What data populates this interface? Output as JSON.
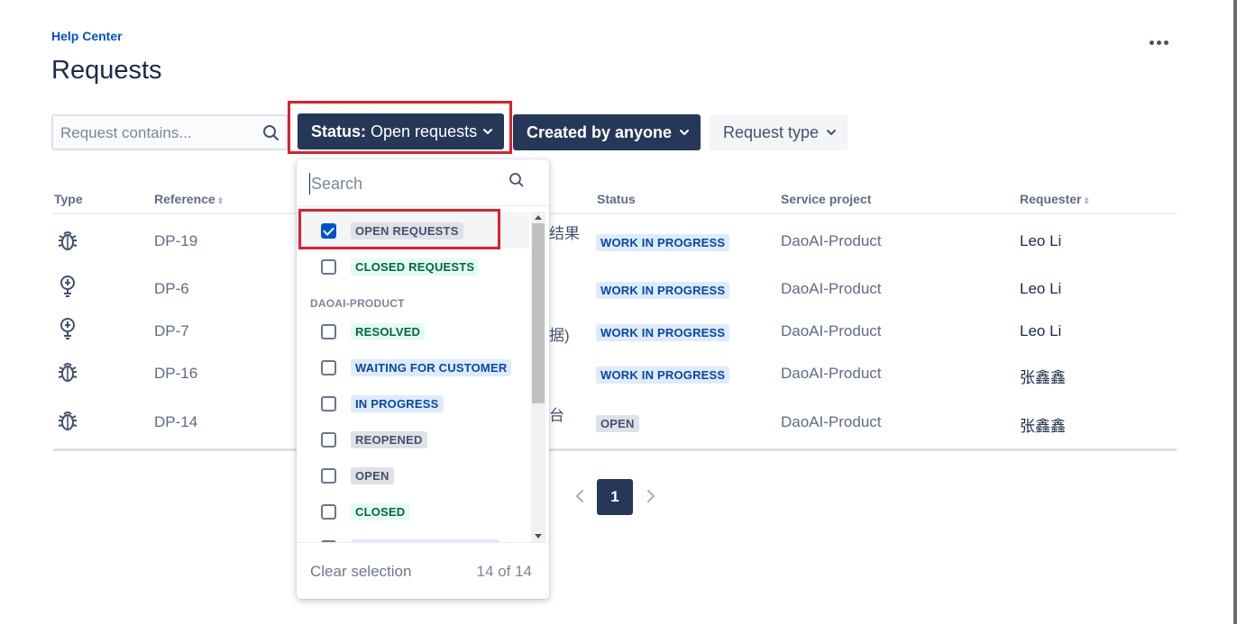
{
  "header": {
    "breadcrumb": "Help Center",
    "title": "Requests",
    "more_icon": "more-horizontal-icon"
  },
  "filters": {
    "search_placeholder": "Request contains...",
    "status_prefix": "Status:",
    "status_value": "Open requests",
    "created_by": "Created by anyone",
    "request_type": "Request type"
  },
  "table": {
    "columns": [
      "Type",
      "Reference",
      "Status",
      "Service project",
      "Requester"
    ],
    "rows": [
      {
        "type_icon": "bug-icon",
        "reference": "DP-19",
        "summary_fragment": "结果",
        "status": "WORK IN PROGRESS",
        "project": "DaoAI-Product",
        "requester": "Leo Li"
      },
      {
        "type_icon": "lightbulb-icon",
        "reference": "DP-6",
        "summary_fragment": "",
        "status": "WORK IN PROGRESS",
        "project": "DaoAI-Product",
        "requester": "Leo Li"
      },
      {
        "type_icon": "lightbulb-icon",
        "reference": "DP-7",
        "summary_fragment": "据)",
        "status": "WORK IN PROGRESS",
        "project": "DaoAI-Product",
        "requester": "Leo Li"
      },
      {
        "type_icon": "bug-icon",
        "reference": "DP-16",
        "summary_fragment": "",
        "status": "WORK IN PROGRESS",
        "project": "DaoAI-Product",
        "requester": "张鑫鑫"
      },
      {
        "type_icon": "bug-icon",
        "reference": "DP-14",
        "summary_fragment": "台",
        "status": "OPEN",
        "project": "DaoAI-Product",
        "requester": "张鑫鑫"
      }
    ]
  },
  "pagination": {
    "current_page": "1"
  },
  "status_dropdown": {
    "search_placeholder": "Search",
    "items": [
      {
        "label": "OPEN REQUESTS",
        "checked": true,
        "color": "grey"
      },
      {
        "label": "CLOSED REQUESTS",
        "checked": false,
        "color": "green"
      }
    ],
    "group_label": "DAOAI-PRODUCT",
    "group_items": [
      {
        "label": "RESOLVED",
        "checked": false,
        "color": "green"
      },
      {
        "label": "WAITING FOR CUSTOMER",
        "checked": false,
        "color": "blue"
      },
      {
        "label": "IN PROGRESS",
        "checked": false,
        "color": "blue"
      },
      {
        "label": "REOPENED",
        "checked": false,
        "color": "grey"
      },
      {
        "label": "OPEN",
        "checked": false,
        "color": "grey"
      },
      {
        "label": "CLOSED",
        "checked": false,
        "color": "green"
      }
    ],
    "clear_label": "Clear selection",
    "count_label": "14 of 14"
  },
  "colors": {
    "brand_dark": "#253858",
    "link": "#0052cc",
    "highlight_red": "#e01e2a"
  }
}
